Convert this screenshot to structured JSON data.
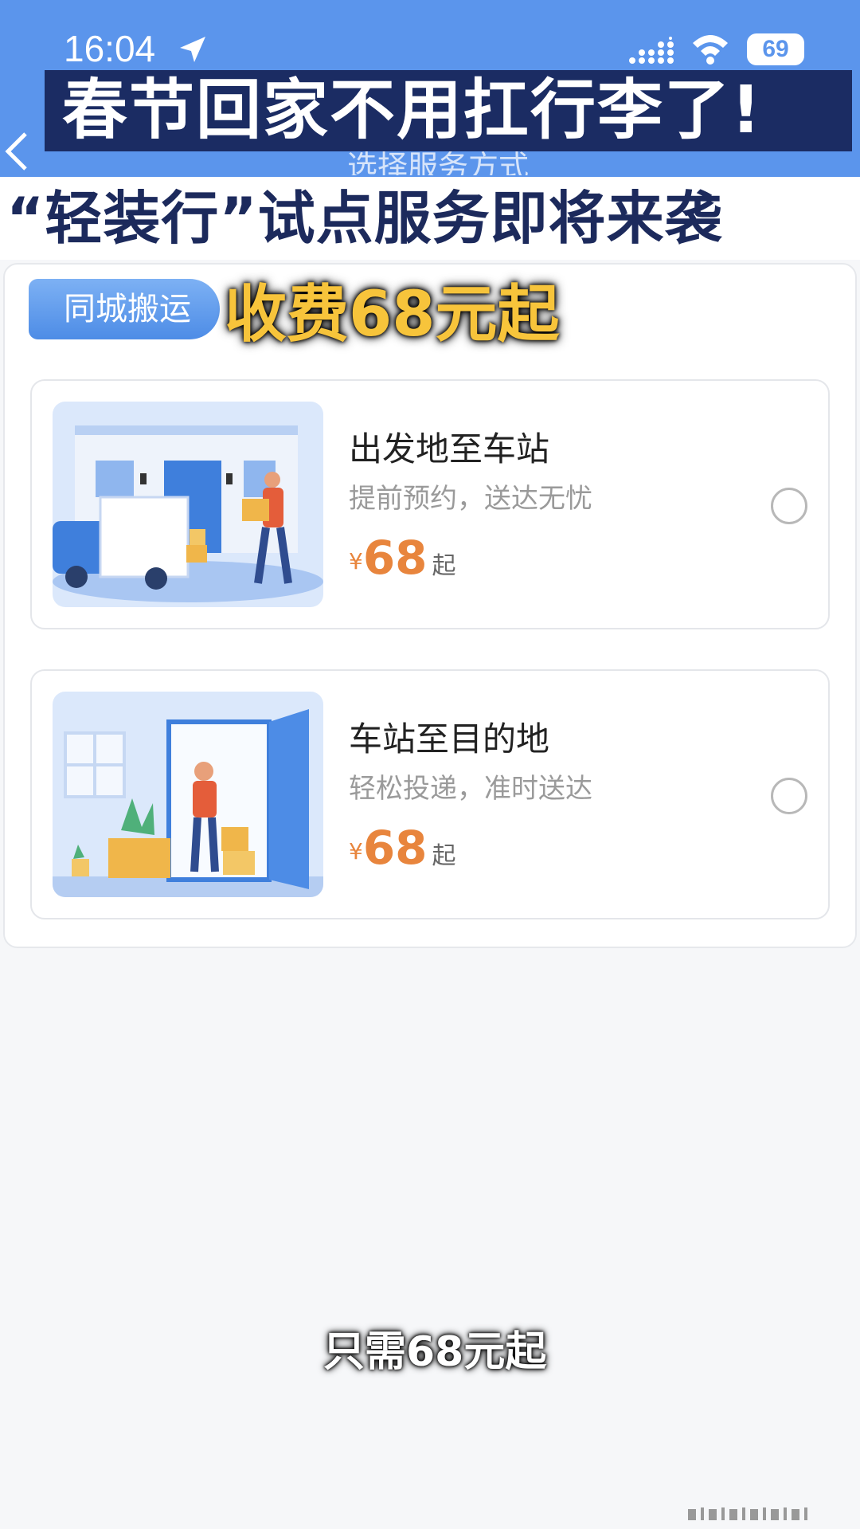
{
  "status_bar": {
    "time": "16:04",
    "battery": "69"
  },
  "nav": {
    "title": "选择服务方式"
  },
  "banners": {
    "headline": "春节回家不用扛行李了!",
    "subhead": "“轻装行”试点服务即将来袭",
    "price_caption": "收费68元起"
  },
  "tab": {
    "label": "同城搬运"
  },
  "services": [
    {
      "title": "出发地至车站",
      "subtitle": "提前预约，送达无忧",
      "currency": "¥",
      "price": "68",
      "suffix": "起",
      "selected": false
    },
    {
      "title": "车站至目的地",
      "subtitle": "轻松投递，准时送达",
      "currency": "¥",
      "price": "68",
      "suffix": "起",
      "selected": false
    }
  ],
  "subtitle_caption": "只需68元起",
  "colors": {
    "header": "#5b95ec",
    "price": "#e8853d",
    "banner_dark": "#1b2c63",
    "banner_yellow": "#f7c43b"
  }
}
